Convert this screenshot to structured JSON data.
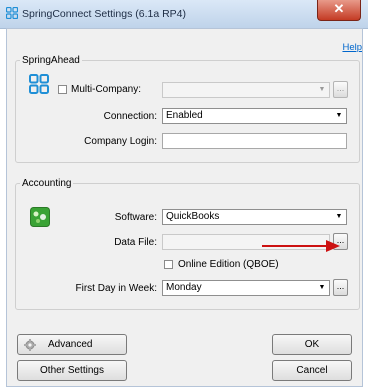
{
  "window": {
    "title": "SpringConnect Settings (6.1a RP4)",
    "close_glyph": "✕"
  },
  "help_label": "Help",
  "springahead": {
    "group_label": "SpringAhead",
    "multi_company_label": "Multi-Company:",
    "multi_company_value": "",
    "connection_label": "Connection:",
    "connection_value": "Enabled",
    "company_login_label": "Company Login:",
    "company_login_value": "",
    "browse_label": "..."
  },
  "accounting": {
    "group_label": "Accounting",
    "software_label": "Software:",
    "software_value": "QuickBooks",
    "data_file_label": "Data File:",
    "data_file_value": "",
    "browse_label": "...",
    "online_edition_label": "Online Edition (QBOE)",
    "first_day_label": "First Day in Week:",
    "first_day_value": "Monday",
    "first_day_browse_label": "..."
  },
  "buttons": {
    "advanced": "Advanced",
    "ok": "OK",
    "other_settings": "Other Settings",
    "cancel": "Cancel"
  },
  "colors": {
    "accent_arrow": "#cc1111",
    "springahead_icon": "#1f8fd6",
    "accounting_icon": "#3aa335"
  },
  "icons": {
    "app": "springahead-logo-icon",
    "springahead_group": "springahead-logo-icon",
    "accounting_group": "quickbooks-icon",
    "advanced": "gear-icon",
    "annotation": "red-arrow-icon"
  }
}
